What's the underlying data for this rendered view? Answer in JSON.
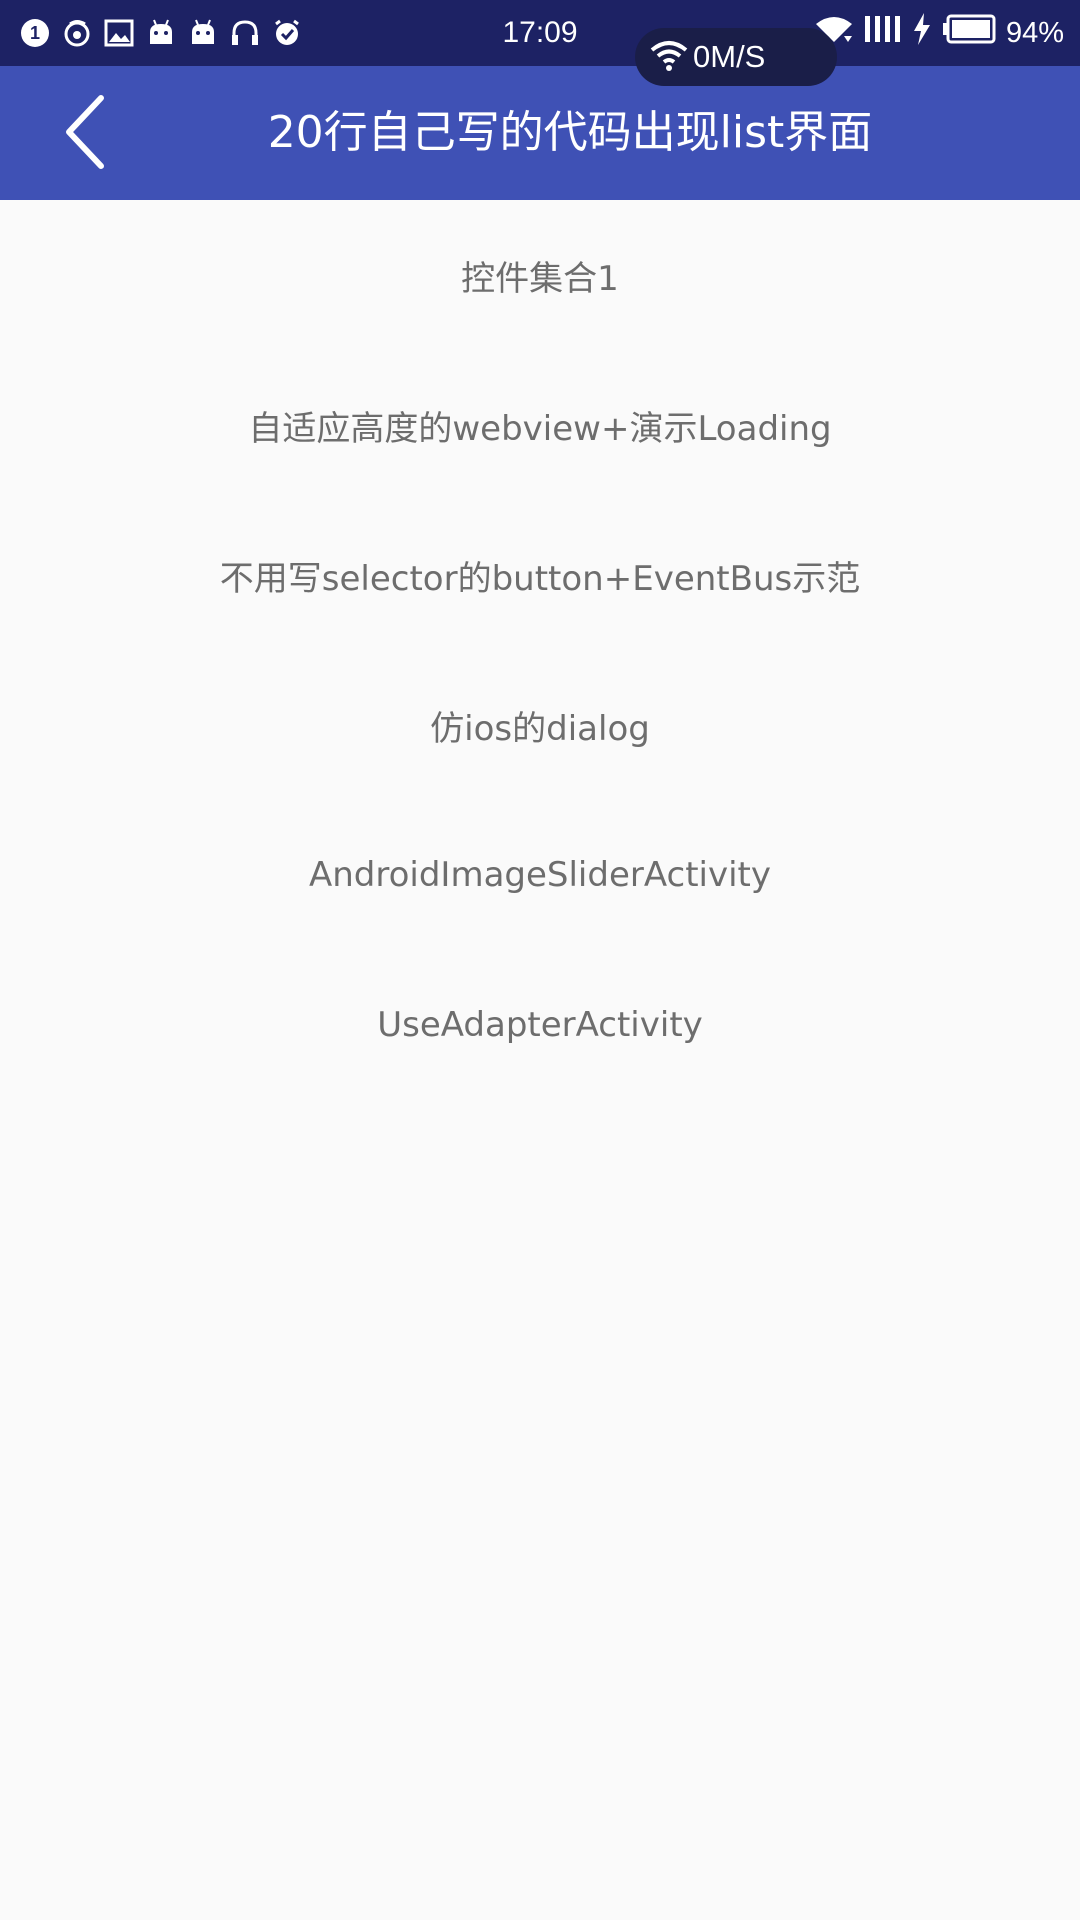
{
  "status_bar": {
    "time": "17:09",
    "battery_percent": "94%",
    "network_speed": "0M/S",
    "left_icons": [
      "notification-one-icon",
      "weibo-icon",
      "image-icon",
      "android-icon",
      "android-icon",
      "headphones-icon",
      "alarm-icon"
    ],
    "right_icons": [
      "wifi-icon",
      "signal-icon",
      "charging-icon",
      "battery-icon"
    ]
  },
  "toolbar": {
    "title": "20行自己写的代码出现list界面",
    "back_icon": "chevron-left-icon",
    "color": "#3f51b5"
  },
  "list": {
    "items": [
      {
        "label": "控件集合1"
      },
      {
        "label": "自适应高度的webview+演示Loading"
      },
      {
        "label": "不用写selector的button+EventBus示范"
      },
      {
        "label": "仿ios的dialog"
      },
      {
        "label": "AndroidImageSliderActivity"
      },
      {
        "label": "UseAdapterActivity"
      }
    ]
  },
  "colors": {
    "status_bar": "#1d2264",
    "background": "#fafafa",
    "list_text": "#6d6d6d"
  }
}
